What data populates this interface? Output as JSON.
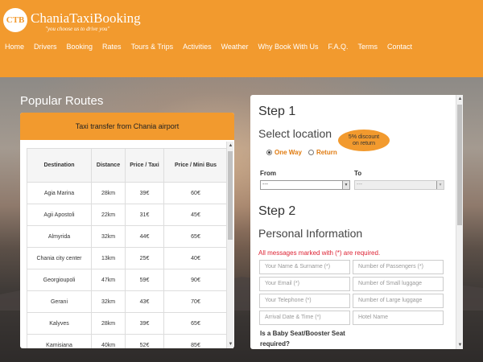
{
  "logo": {
    "initials": "CTB",
    "name": "ChaniaTaxiBooking",
    "tagline": "\"you choose us to drive you\""
  },
  "nav": [
    "Home",
    "Drivers",
    "Booking",
    "Rates",
    "Tours & Trips",
    "Activities",
    "Weather",
    "Why Book With Us",
    "F.A.Q.",
    "Terms",
    "Contact"
  ],
  "routes": {
    "title": "Popular Routes",
    "header": "Taxi transfer from Chania airport",
    "columns": [
      "Destination",
      "Distance",
      "Price / Taxi",
      "Price / Mini Bus"
    ],
    "rows": [
      [
        "Agia Marina",
        "28km",
        "39€",
        "60€"
      ],
      [
        "Agii Apostoli",
        "22km",
        "31€",
        "45€"
      ],
      [
        "Almyrida",
        "32km",
        "44€",
        "65€"
      ],
      [
        "Chania city center",
        "13km",
        "25€",
        "40€"
      ],
      [
        "Georgioupoli",
        "47km",
        "59€",
        "90€"
      ],
      [
        "Gerani",
        "32km",
        "43€",
        "70€"
      ],
      [
        "Kalyves",
        "28km",
        "39€",
        "65€"
      ],
      [
        "Kamisiana",
        "40km",
        "52€",
        "85€"
      ]
    ]
  },
  "form": {
    "step1": "Step 1",
    "select_location": "Select location",
    "discount_line1": "5% discount",
    "discount_line2": "on return",
    "one_way": "One Way",
    "return": "Return",
    "from_label": "From",
    "to_label": "To",
    "from_value": "---",
    "to_value": "---",
    "step2": "Step 2",
    "personal_info": "Personal Information",
    "required_msg": "All messages marked with (*) are required.",
    "placeholders": {
      "name": "Your Name & Surname (*)",
      "passengers": "Number of Passengers (*)",
      "email": "Your Email (*)",
      "small_luggage": "Number of Small luggage",
      "telephone": "Your Telephone (*)",
      "large_luggage": "Number of Large luggage",
      "arrival": "Arrival Date & Time (*)",
      "hotel": "Hotel Name"
    },
    "baby_seat": "Is a Baby Seat/Booster Seat required?"
  },
  "colors": {
    "brand": "#f29a2e",
    "required": "#d23"
  }
}
